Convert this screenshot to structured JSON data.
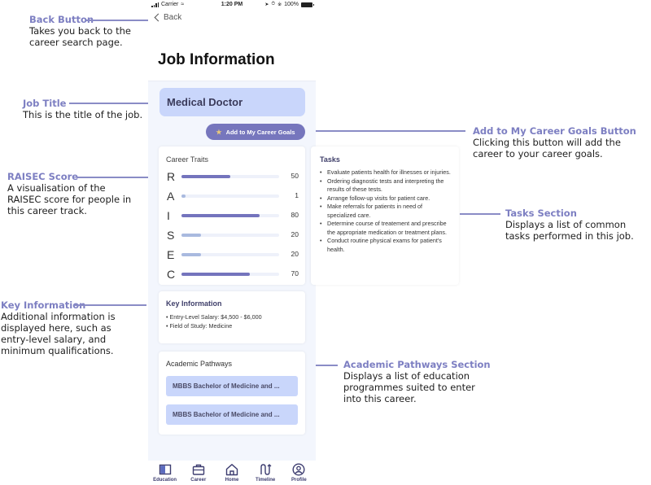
{
  "status_bar": {
    "carrier": "Carrier",
    "time": "1:20 PM",
    "battery": "100%"
  },
  "nav": {
    "back_label": "Back"
  },
  "page": {
    "title": "Job Information",
    "job_title": "Medical Doctor",
    "add_goal_label": "Add to My Career Goals"
  },
  "career_traits": {
    "title": "Career Traits",
    "items": [
      {
        "letter": "R",
        "value": "50",
        "fraction": 0.5,
        "color": "#7474bd"
      },
      {
        "letter": "A",
        "value": "1",
        "fraction": 0.04,
        "color": "#a9badf"
      },
      {
        "letter": "I",
        "value": "80",
        "fraction": 0.8,
        "color": "#7474bd"
      },
      {
        "letter": "S",
        "value": "20",
        "fraction": 0.2,
        "color": "#a9badf"
      },
      {
        "letter": "E",
        "value": "20",
        "fraction": 0.2,
        "color": "#a9badf"
      },
      {
        "letter": "C",
        "value": "70",
        "fraction": 0.7,
        "color": "#7474bd"
      }
    ]
  },
  "tasks": {
    "title": "Tasks",
    "items": [
      "Evaluate patients health for illnesses or injuries.",
      "Ordering diagnostic tests and interpreting the results of these tests.",
      "Arrange follow-up visits for patient care.",
      "Make referrals for patients in need of specialized care.",
      "Determine course of treatement and prescribe the appropriate medication or treatment plans.",
      "Conduct routine physical exams for patient's health."
    ]
  },
  "key_information": {
    "title": "Key Information",
    "items": [
      "Entry-Level Salary: $4,500 - $6,000",
      "Field of Study: Medicine"
    ]
  },
  "academic_pathways": {
    "title": "Academic Pathways",
    "items": [
      "MBBS Bachelor of Medicine and ...",
      "MBBS Bachelor of Medicine and ..."
    ]
  },
  "tabbar": {
    "items": [
      {
        "label": "Education",
        "icon": "book-icon"
      },
      {
        "label": "Career",
        "icon": "briefcase-icon"
      },
      {
        "label": "Home",
        "icon": "home-icon"
      },
      {
        "label": "Timeline",
        "icon": "timeline-icon"
      },
      {
        "label": "Profile",
        "icon": "profile-icon"
      }
    ]
  },
  "annotations": {
    "back": {
      "title": "Back Button",
      "desc": "Takes you back to the career search page."
    },
    "job_title": {
      "title": "Job Title",
      "desc": "This is the title of the job."
    },
    "raisec": {
      "title": "RAISEC Score",
      "desc": "A visualisation of the RAISEC score for people in this career track."
    },
    "key_info": {
      "title": "Key Information",
      "desc": "Additional information is displayed here, such as entry-level salary, and minimum qualifications."
    },
    "add_goals": {
      "title": "Add to My Career Goals Button",
      "desc": "Clicking this button will add the career to your career goals."
    },
    "tasks": {
      "title": "Tasks Section",
      "desc": "Displays a list of common tasks performed in this job."
    },
    "pathways": {
      "title": "Academic Pathways Section",
      "desc": "Displays a list of education programmes suited to enter into this career."
    }
  },
  "colors": {
    "accent": "#7676bd",
    "highlight": "#c9d6fb",
    "annotation": "#7d7fc2",
    "background": "#f3f6fd"
  }
}
